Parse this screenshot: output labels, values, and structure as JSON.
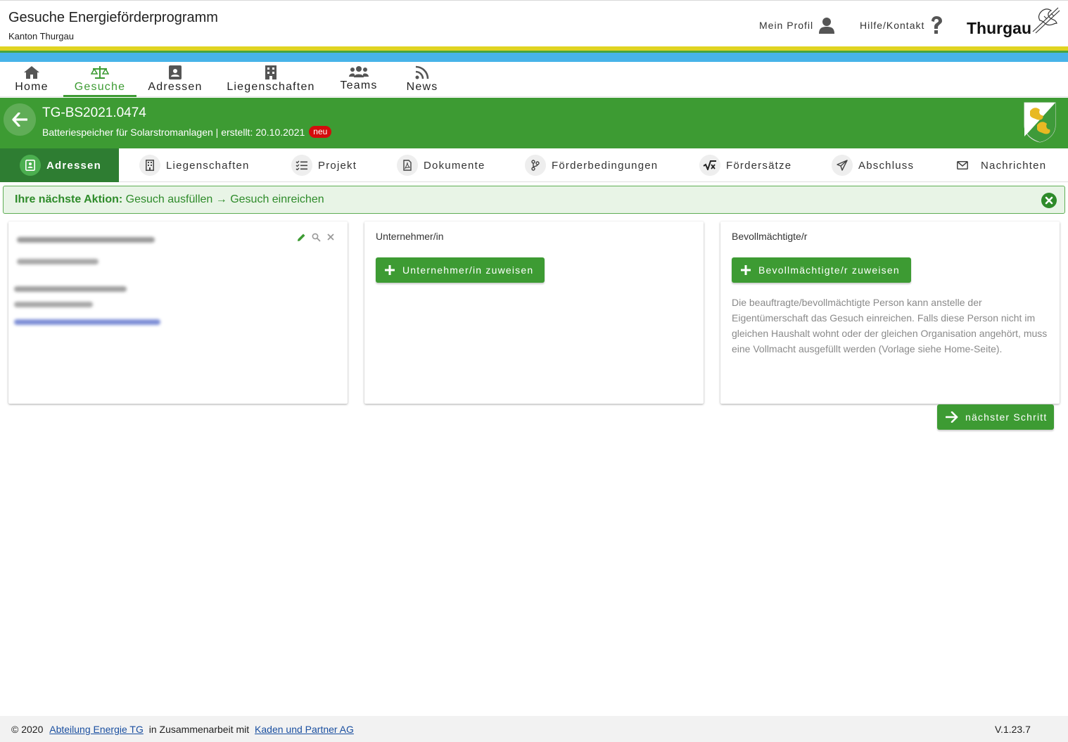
{
  "header": {
    "app_title": "Gesuche Energieförderprogramm",
    "app_subtitle": "Kanton Thurgau",
    "profile_label": "Mein Profil",
    "help_label": "Hilfe/Kontakt",
    "brand": "Thurgau"
  },
  "nav": {
    "items": [
      {
        "label": "Home",
        "icon": "home-icon"
      },
      {
        "label": "Gesuche",
        "icon": "scale-icon",
        "active": true
      },
      {
        "label": "Adressen",
        "icon": "contact-icon"
      },
      {
        "label": "Liegenschaften",
        "icon": "building-icon"
      },
      {
        "label": "Teams",
        "icon": "users-icon"
      },
      {
        "label": "News",
        "icon": "rss-icon"
      }
    ]
  },
  "request": {
    "id": "TG-BS2021.0474",
    "subtitle": "Batteriespeicher für Solarstromanlagen | erstellt: 20.10.2021",
    "badge": "neu"
  },
  "tabs": [
    {
      "label": "Adressen",
      "icon": "contact-icon",
      "active": true
    },
    {
      "label": "Liegenschaften",
      "icon": "building-icon"
    },
    {
      "label": "Projekt",
      "icon": "checklist-icon"
    },
    {
      "label": "Dokumente",
      "icon": "pdf-icon"
    },
    {
      "label": "Förderbedingungen",
      "icon": "branch-icon"
    },
    {
      "label": "Fördersätze",
      "icon": "formula-icon"
    },
    {
      "label": "Abschluss",
      "icon": "send-icon"
    },
    {
      "label": "Nachrichten",
      "icon": "mail-icon"
    }
  ],
  "action_banner": {
    "prefix": "Ihre nächste Aktion:",
    "text": "Gesuch ausfüllen → Gesuch einreichen"
  },
  "cards": {
    "contractor": {
      "label": "Unternehmer/in",
      "button": "Unternehmer/in zuweisen"
    },
    "authorized": {
      "label": "Bevollmächtigte/r",
      "button": "Bevollmächtigte/r zuweisen",
      "help": "Die beauftragte/bevollmächtigte Person kann anstelle der Eigentümerschaft das Gesuch einreichen. Falls diese Person nicht im gleichen Haushalt wohnt oder der gleichen Organisation angehört, muss eine Vollmacht ausgefüllt werden (Vorlage siehe Home-Seite)."
    }
  },
  "next_button": "nächster Schritt",
  "footer": {
    "copyright": "© 2020",
    "link1": "Abteilung Energie TG",
    "middle": "in Zusammenarbeit mit",
    "link2": "Kaden und Partner AG",
    "version": "V.1.23.7"
  },
  "colors": {
    "primary_green": "#3d9b33",
    "dark_green": "#2e7d32",
    "stripe_yellow": "#e0d421",
    "stripe_blue": "#47b3e8",
    "badge_red": "#d40c0c"
  }
}
